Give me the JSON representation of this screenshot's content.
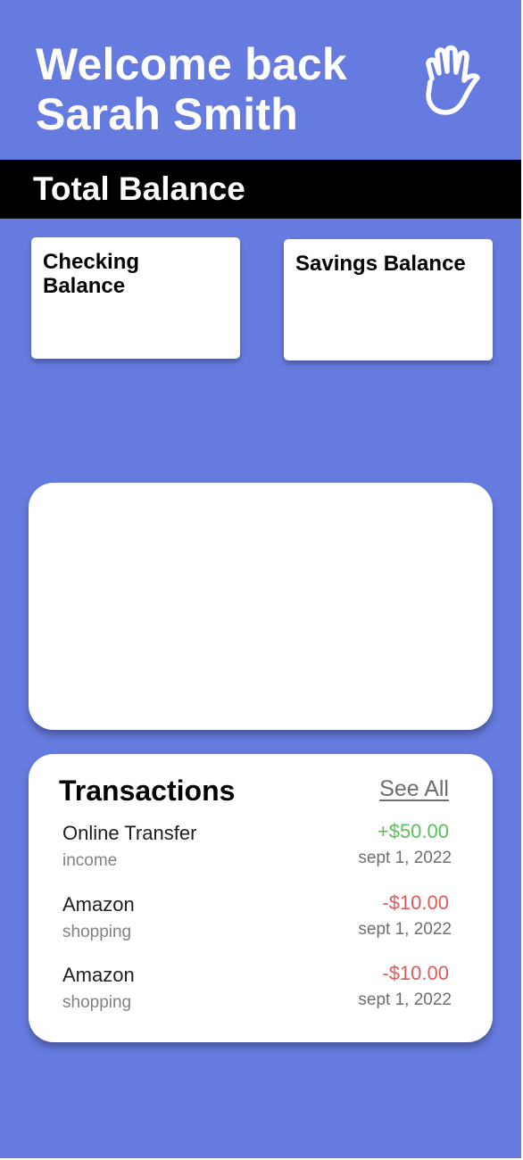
{
  "header": {
    "welcome_line1": "Welcome back",
    "welcome_line2": "Sarah Smith",
    "wave_icon": "waving-hand-icon"
  },
  "total_balance": {
    "label": "Total Balance"
  },
  "balances": {
    "checking_label": "Checking Balance",
    "savings_label": "Savings Balance"
  },
  "transactions": {
    "title": "Transactions",
    "see_all_label": "See All",
    "items": [
      {
        "name": "Online Transfer",
        "category": "income",
        "amount": "+$50.00",
        "date": "sept 1, 2022",
        "type": "credit"
      },
      {
        "name": "Amazon",
        "category": "shopping",
        "amount": "-$10.00",
        "date": "sept 1, 2022",
        "type": "debit"
      },
      {
        "name": "Amazon",
        "category": "shopping",
        "amount": "-$10.00",
        "date": "sept 1, 2022",
        "type": "debit"
      }
    ]
  },
  "colors": {
    "background": "#667be0",
    "bar": "#000000",
    "card": "#ffffff",
    "credit": "#5cc15c",
    "debit": "#e05a5a"
  }
}
